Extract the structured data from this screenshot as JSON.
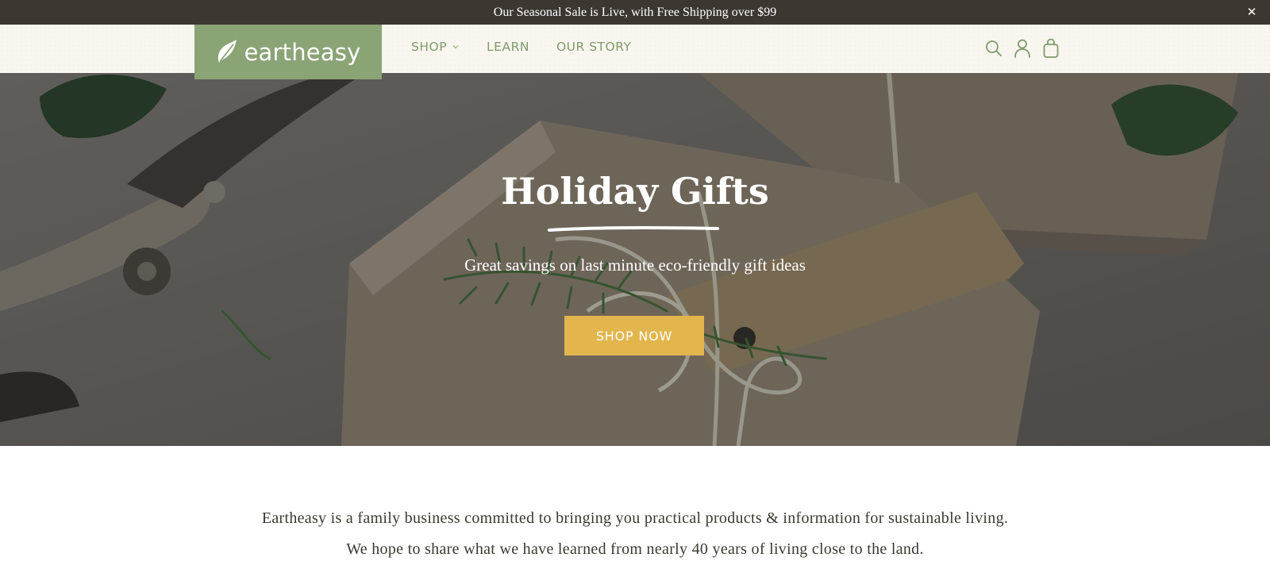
{
  "announcement": {
    "text": "Our Seasonal Sale is Live, with Free Shipping over $99",
    "close_icon": "close-icon"
  },
  "header": {
    "logo_text": "eartheasy",
    "nav": [
      {
        "label": "SHOP",
        "has_dropdown": true
      },
      {
        "label": "LEARN",
        "has_dropdown": false
      },
      {
        "label": "OUR STORY",
        "has_dropdown": false
      }
    ],
    "icons": [
      "search-icon",
      "account-icon",
      "cart-icon"
    ]
  },
  "hero": {
    "title": "Holiday Gifts",
    "subtitle": "Great savings on last minute eco-friendly gift ideas",
    "button_label": "SHOP NOW"
  },
  "intro": {
    "line1": "Eartheasy is a family business committed to bringing you practical products & information for sustainable living.",
    "line2": "We hope to share what we have learned from nearly 40 years of living close to the land."
  },
  "colors": {
    "announcement_bg": "#3d3732",
    "header_bg": "#f8f6ef",
    "brand_green": "#8aa476",
    "nav_text": "#7f9a6b",
    "button_gold": "#e2b64c",
    "body_text": "#3a3a32"
  }
}
